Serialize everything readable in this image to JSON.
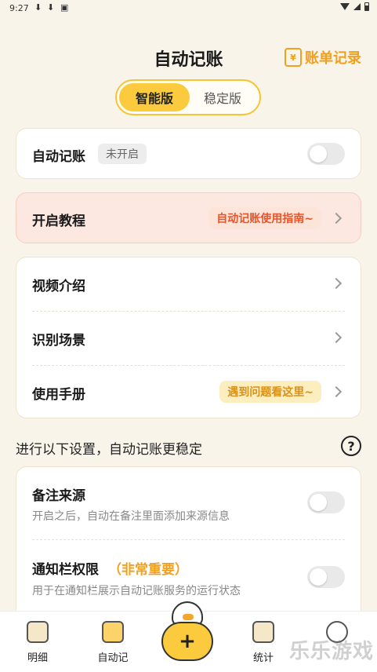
{
  "status_bar": {
    "time": "9:27"
  },
  "header": {
    "title": "自动记账",
    "bill_record": "账单记录",
    "bill_icon_glyph": "¥"
  },
  "segment": {
    "active": "智能版",
    "inactive": "稳定版"
  },
  "auto_card": {
    "label": "自动记账",
    "status": "未开启"
  },
  "tutorial_card": {
    "label": "开启教程",
    "tag": "自动记账使用指南~"
  },
  "help_list": {
    "items": [
      {
        "label": "视频介绍"
      },
      {
        "label": "识别场景"
      },
      {
        "label": "使用手册",
        "tag": "遇到问题看这里~"
      }
    ]
  },
  "section": {
    "title": "进行以下设置，自动记账更稳定",
    "help_glyph": "?"
  },
  "settings": {
    "remark_source": {
      "label": "备注来源",
      "desc": "开启之后，自动在备注里面添加来源信息"
    },
    "notification": {
      "label": "通知栏权限",
      "important": "（非常重要）",
      "desc": "用于在通知栏展示自动记账服务的运行状态"
    }
  },
  "bottom_nav": {
    "items": [
      {
        "label": "明细"
      },
      {
        "label": "自动记"
      },
      {
        "label": "统计"
      }
    ],
    "fab_glyph": "+"
  },
  "watermark": "乐乐游戏"
}
